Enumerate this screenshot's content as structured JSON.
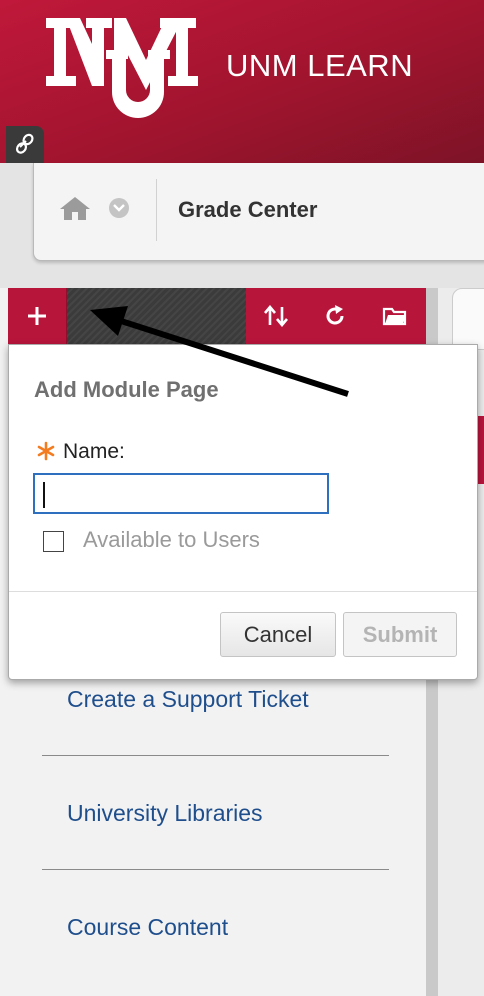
{
  "header": {
    "brand": "UNM LEARN",
    "logo_icon": "unm-logo-icon"
  },
  "breadcrumb": {
    "current": "Grade Center"
  },
  "toolbar": {
    "add_icon": "plus-icon",
    "sort_icon": "sort-arrows-icon",
    "refresh_icon": "refresh-icon",
    "folder_icon": "folder-icon"
  },
  "popup": {
    "title": "Add Module Page",
    "name_label": "Name:",
    "name_value": "",
    "available_label": "Available to Users",
    "cancel_label": "Cancel",
    "submit_label": "Submit"
  },
  "menu": {
    "items": [
      {
        "label": "Create a Support Ticket"
      },
      {
        "label": "University Libraries"
      },
      {
        "label": "Course Content"
      }
    ]
  },
  "colors": {
    "brand_red": "#b8153b",
    "link_blue": "#1f4e8c",
    "focus_blue": "#2f6fbf",
    "required": "#f47c20"
  }
}
